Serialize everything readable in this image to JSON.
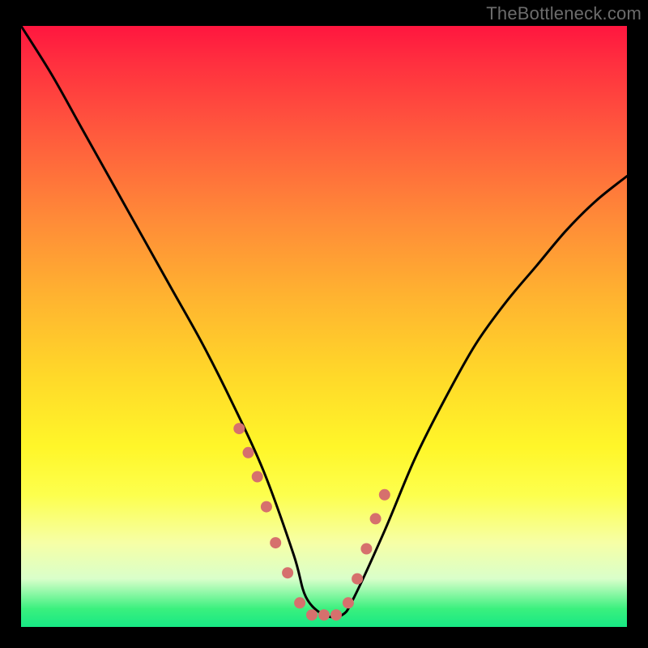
{
  "watermark": "TheBottleneck.com",
  "chart_data": {
    "type": "line",
    "title": "",
    "xlabel": "",
    "ylabel": "",
    "xlim": [
      0,
      100
    ],
    "ylim": [
      0,
      100
    ],
    "series": [
      {
        "name": "bottleneck-curve",
        "x": [
          0,
          5,
          10,
          15,
          20,
          25,
          30,
          35,
          40,
          45,
          47,
          50,
          53,
          55,
          60,
          65,
          70,
          75,
          80,
          85,
          90,
          95,
          100
        ],
        "values": [
          100,
          92,
          83,
          74,
          65,
          56,
          47,
          37,
          26,
          12,
          5,
          2,
          2,
          5,
          16,
          28,
          38,
          47,
          54,
          60,
          66,
          71,
          75
        ]
      }
    ],
    "markers": {
      "name": "highlight-dots",
      "color": "#d6706d",
      "x": [
        36,
        37.5,
        39,
        40.5,
        42,
        44,
        46,
        48,
        50,
        52,
        54,
        55.5,
        57,
        58.5,
        60
      ],
      "values": [
        33,
        29,
        25,
        20,
        14,
        9,
        4,
        2,
        2,
        2,
        4,
        8,
        13,
        18,
        22
      ]
    },
    "gradient_stops": [
      {
        "pos": 0,
        "color": "#ff163f"
      },
      {
        "pos": 6,
        "color": "#ff2f3f"
      },
      {
        "pos": 18,
        "color": "#ff5a3d"
      },
      {
        "pos": 32,
        "color": "#ff8a38"
      },
      {
        "pos": 45,
        "color": "#ffb330"
      },
      {
        "pos": 58,
        "color": "#ffd829"
      },
      {
        "pos": 70,
        "color": "#fff629"
      },
      {
        "pos": 78,
        "color": "#fdff4d"
      },
      {
        "pos": 86,
        "color": "#f6ffa6"
      },
      {
        "pos": 92,
        "color": "#d9ffca"
      },
      {
        "pos": 97,
        "color": "#3af07e"
      },
      {
        "pos": 100,
        "color": "#17e884"
      }
    ]
  }
}
